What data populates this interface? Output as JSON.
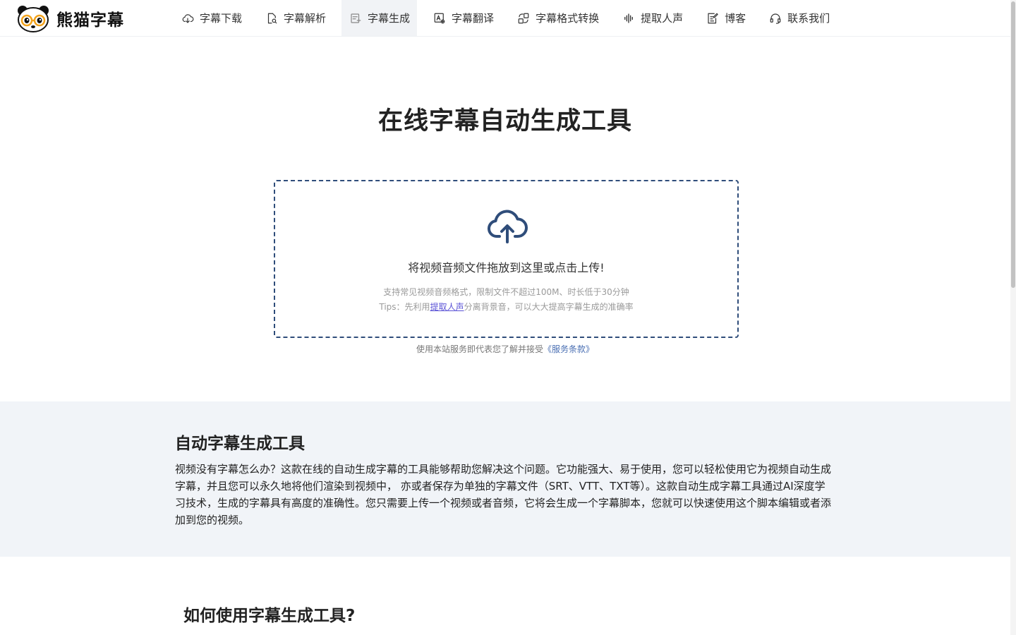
{
  "brand": {
    "name": "熊猫字幕"
  },
  "nav": {
    "items": [
      {
        "label": "字幕下载",
        "icon": "cloud-download-icon"
      },
      {
        "label": "字幕解析",
        "icon": "file-search-icon"
      },
      {
        "label": "字幕生成",
        "icon": "subtitle-generate-icon",
        "active": true
      },
      {
        "label": "字幕翻译",
        "icon": "translate-icon"
      },
      {
        "label": "字幕格式转换",
        "icon": "format-convert-icon"
      },
      {
        "label": "提取人声",
        "icon": "audio-wave-icon"
      },
      {
        "label": "博客",
        "icon": "blog-edit-icon"
      },
      {
        "label": "联系我们",
        "icon": "headset-icon"
      }
    ]
  },
  "hero": {
    "title": "在线字幕自动生成工具"
  },
  "upload": {
    "icon": "cloud-upload-icon",
    "main_text": "将视频音频文件拖放到这里或点击上传!",
    "sub_text": "支持常见视频音频格式，限制文件不超过100M、时长低于30分钟",
    "tips_prefix": "Tips：先利用",
    "tips_link": "提取人声",
    "tips_suffix": "分离背景音，可以大大提高字幕生成的准确率"
  },
  "terms": {
    "prefix": "使用本站服务即代表您了解并接受",
    "link": "《服务条款》"
  },
  "intro": {
    "title": "自动字幕生成工具",
    "body": "视频没有字幕怎么办？这款在线的自动生成字幕的工具能够帮助您解决这个问题。它功能强大、易于使用，您可以轻松使用它为视频自动生成字幕，并且您可以永久地将他们渲染到视频中， 亦或者保存为单独的字幕文件（SRT、VTT、TXT等）。这款自动生成字幕工具通过AI深度学习技术，生成的字幕具有高度的准确性。您只需要上传一个视频或者音频，它将会生成一个字幕脚本，您就可以快速使用这个脚本编辑或者添加到您的视频。"
  },
  "howto": {
    "title": "如何使用字幕生成工具?"
  },
  "colors": {
    "accent": "#2f4d7a",
    "link": "#5b53d6",
    "section_bg": "#f1f4f8",
    "nav_active_bg": "#f1f3f6"
  }
}
